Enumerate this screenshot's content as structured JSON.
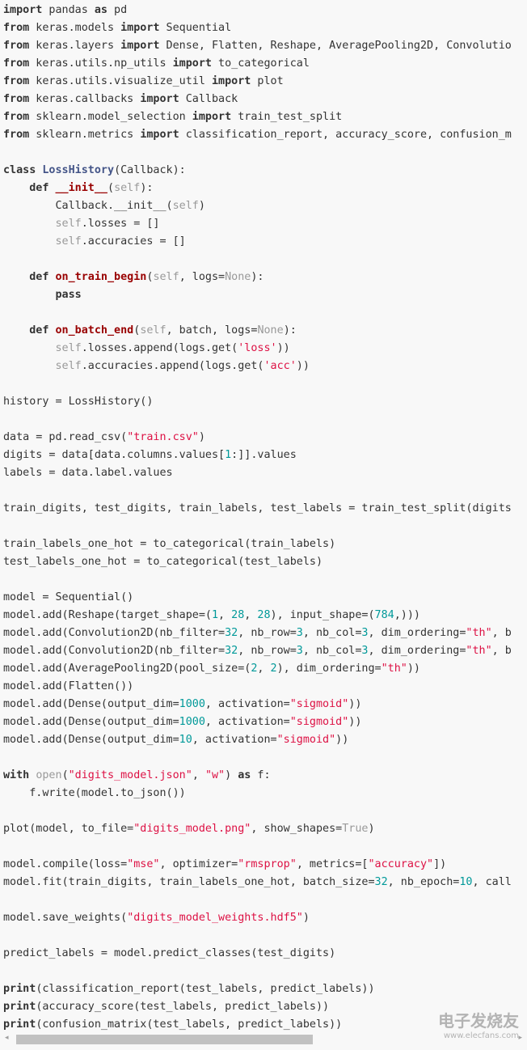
{
  "colors": {
    "background": "#f8f8f8",
    "keyword": "#333333",
    "function_name": "#990000",
    "class_name": "#445588",
    "self": "#999999",
    "string": "#dd1144",
    "number": "#009999"
  },
  "code_lines": [
    [
      [
        "k",
        "import"
      ],
      [
        "p",
        " pandas "
      ],
      [
        "k",
        "as"
      ],
      [
        "p",
        " pd"
      ]
    ],
    [
      [
        "k",
        "from"
      ],
      [
        "p",
        " keras.models "
      ],
      [
        "k",
        "import"
      ],
      [
        "p",
        " Sequential"
      ]
    ],
    [
      [
        "k",
        "from"
      ],
      [
        "p",
        " keras.layers "
      ],
      [
        "k",
        "import"
      ],
      [
        "p",
        " Dense, Flatten, Reshape, AveragePooling2D, Convolutio"
      ]
    ],
    [
      [
        "k",
        "from"
      ],
      [
        "p",
        " keras.utils.np_utils "
      ],
      [
        "k",
        "import"
      ],
      [
        "p",
        " to_categorical"
      ]
    ],
    [
      [
        "k",
        "from"
      ],
      [
        "p",
        " keras.utils.visualize_util "
      ],
      [
        "k",
        "import"
      ],
      [
        "p",
        " plot"
      ]
    ],
    [
      [
        "k",
        "from"
      ],
      [
        "p",
        " keras.callbacks "
      ],
      [
        "k",
        "import"
      ],
      [
        "p",
        " Callback"
      ]
    ],
    [
      [
        "k",
        "from"
      ],
      [
        "p",
        " sklearn.model_selection "
      ],
      [
        "k",
        "import"
      ],
      [
        "p",
        " train_test_split"
      ]
    ],
    [
      [
        "k",
        "from"
      ],
      [
        "p",
        " sklearn.metrics "
      ],
      [
        "k",
        "import"
      ],
      [
        "p",
        " classification_report, accuracy_score, confusion_m"
      ]
    ],
    [],
    [
      [
        "k",
        "class"
      ],
      [
        "p",
        " "
      ],
      [
        "c",
        "LossHistory"
      ],
      [
        "p",
        "(Callback):"
      ]
    ],
    [
      [
        "p",
        "    "
      ],
      [
        "k",
        "def"
      ],
      [
        "p",
        " "
      ],
      [
        "f",
        "__init__"
      ],
      [
        "p",
        "("
      ],
      [
        "s",
        "self"
      ],
      [
        "p",
        "):"
      ]
    ],
    [
      [
        "p",
        "        Callback.__init__("
      ],
      [
        "s",
        "self"
      ],
      [
        "p",
        ")"
      ]
    ],
    [
      [
        "p",
        "        "
      ],
      [
        "s",
        "self"
      ],
      [
        "p",
        ".losses = []"
      ]
    ],
    [
      [
        "p",
        "        "
      ],
      [
        "s",
        "self"
      ],
      [
        "p",
        ".accuracies = []"
      ]
    ],
    [],
    [
      [
        "p",
        "    "
      ],
      [
        "k",
        "def"
      ],
      [
        "p",
        " "
      ],
      [
        "f",
        "on_train_begin"
      ],
      [
        "p",
        "("
      ],
      [
        "s",
        "self"
      ],
      [
        "p",
        ", logs="
      ],
      [
        "b",
        "None"
      ],
      [
        "p",
        "):"
      ]
    ],
    [
      [
        "p",
        "        "
      ],
      [
        "k",
        "pass"
      ]
    ],
    [],
    [
      [
        "p",
        "    "
      ],
      [
        "k",
        "def"
      ],
      [
        "p",
        " "
      ],
      [
        "f",
        "on_batch_end"
      ],
      [
        "p",
        "("
      ],
      [
        "s",
        "self"
      ],
      [
        "p",
        ", batch, logs="
      ],
      [
        "b",
        "None"
      ],
      [
        "p",
        "):"
      ]
    ],
    [
      [
        "p",
        "        "
      ],
      [
        "s",
        "self"
      ],
      [
        "p",
        ".losses.append(logs.get("
      ],
      [
        "q",
        "'loss'"
      ],
      [
        "p",
        "))"
      ]
    ],
    [
      [
        "p",
        "        "
      ],
      [
        "s",
        "self"
      ],
      [
        "p",
        ".accuracies.append(logs.get("
      ],
      [
        "q",
        "'acc'"
      ],
      [
        "p",
        "))"
      ]
    ],
    [],
    [
      [
        "p",
        "history = LossHistory()"
      ]
    ],
    [],
    [
      [
        "p",
        "data = pd.read_csv("
      ],
      [
        "q",
        "\"train.csv\""
      ],
      [
        "p",
        ")"
      ]
    ],
    [
      [
        "p",
        "digits = data[data.columns.values["
      ],
      [
        "n",
        "1"
      ],
      [
        "p",
        ":]].values"
      ]
    ],
    [
      [
        "p",
        "labels = data.label.values"
      ]
    ],
    [],
    [
      [
        "p",
        "train_digits, test_digits, train_labels, test_labels = train_test_split(digits"
      ]
    ],
    [],
    [
      [
        "p",
        "train_labels_one_hot = to_categorical(train_labels)"
      ]
    ],
    [
      [
        "p",
        "test_labels_one_hot = to_categorical(test_labels)"
      ]
    ],
    [],
    [
      [
        "p",
        "model = Sequential()"
      ]
    ],
    [
      [
        "p",
        "model.add(Reshape(target_shape=("
      ],
      [
        "n",
        "1"
      ],
      [
        "p",
        ", "
      ],
      [
        "n",
        "28"
      ],
      [
        "p",
        ", "
      ],
      [
        "n",
        "28"
      ],
      [
        "p",
        "), input_shape=("
      ],
      [
        "n",
        "784"
      ],
      [
        "p",
        ",)))"
      ]
    ],
    [
      [
        "p",
        "model.add(Convolution2D(nb_filter="
      ],
      [
        "n",
        "32"
      ],
      [
        "p",
        ", nb_row="
      ],
      [
        "n",
        "3"
      ],
      [
        "p",
        ", nb_col="
      ],
      [
        "n",
        "3"
      ],
      [
        "p",
        ", dim_ordering="
      ],
      [
        "q",
        "\"th\""
      ],
      [
        "p",
        ", b"
      ]
    ],
    [
      [
        "p",
        "model.add(Convolution2D(nb_filter="
      ],
      [
        "n",
        "32"
      ],
      [
        "p",
        ", nb_row="
      ],
      [
        "n",
        "3"
      ],
      [
        "p",
        ", nb_col="
      ],
      [
        "n",
        "3"
      ],
      [
        "p",
        ", dim_ordering="
      ],
      [
        "q",
        "\"th\""
      ],
      [
        "p",
        ", b"
      ]
    ],
    [
      [
        "p",
        "model.add(AveragePooling2D(pool_size=("
      ],
      [
        "n",
        "2"
      ],
      [
        "p",
        ", "
      ],
      [
        "n",
        "2"
      ],
      [
        "p",
        "), dim_ordering="
      ],
      [
        "q",
        "\"th\""
      ],
      [
        "p",
        "))"
      ]
    ],
    [
      [
        "p",
        "model.add(Flatten())"
      ]
    ],
    [
      [
        "p",
        "model.add(Dense(output_dim="
      ],
      [
        "n",
        "1000"
      ],
      [
        "p",
        ", activation="
      ],
      [
        "q",
        "\"sigmoid\""
      ],
      [
        "p",
        "))"
      ]
    ],
    [
      [
        "p",
        "model.add(Dense(output_dim="
      ],
      [
        "n",
        "1000"
      ],
      [
        "p",
        ", activation="
      ],
      [
        "q",
        "\"sigmoid\""
      ],
      [
        "p",
        "))"
      ]
    ],
    [
      [
        "p",
        "model.add(Dense(output_dim="
      ],
      [
        "n",
        "10"
      ],
      [
        "p",
        ", activation="
      ],
      [
        "q",
        "\"sigmoid\""
      ],
      [
        "p",
        "))"
      ]
    ],
    [],
    [
      [
        "k",
        "with"
      ],
      [
        "p",
        " "
      ],
      [
        "b",
        "open"
      ],
      [
        "p",
        "("
      ],
      [
        "q",
        "\"digits_model.json\""
      ],
      [
        "p",
        ", "
      ],
      [
        "q",
        "\"w\""
      ],
      [
        "p",
        ") "
      ],
      [
        "k",
        "as"
      ],
      [
        "p",
        " f:"
      ]
    ],
    [
      [
        "p",
        "    f.write(model.to_json())"
      ]
    ],
    [],
    [
      [
        "p",
        "plot(model, to_file="
      ],
      [
        "q",
        "\"digits_model.png\""
      ],
      [
        "p",
        ", show_shapes="
      ],
      [
        "b",
        "True"
      ],
      [
        "p",
        ")"
      ]
    ],
    [],
    [
      [
        "p",
        "model.compile(loss="
      ],
      [
        "q",
        "\"mse\""
      ],
      [
        "p",
        ", optimizer="
      ],
      [
        "q",
        "\"rmsprop\""
      ],
      [
        "p",
        ", metrics=["
      ],
      [
        "q",
        "\"accuracy\""
      ],
      [
        "p",
        "])"
      ]
    ],
    [
      [
        "p",
        "model.fit(train_digits, train_labels_one_hot, batch_size="
      ],
      [
        "n",
        "32"
      ],
      [
        "p",
        ", nb_epoch="
      ],
      [
        "n",
        "10"
      ],
      [
        "p",
        ", call"
      ]
    ],
    [],
    [
      [
        "p",
        "model.save_weights("
      ],
      [
        "q",
        "\"digits_model_weights.hdf5\""
      ],
      [
        "p",
        ")"
      ]
    ],
    [],
    [
      [
        "p",
        "predict_labels = model.predict_classes(test_digits)"
      ]
    ],
    [],
    [
      [
        "k",
        "print"
      ],
      [
        "p",
        "(classification_report(test_labels, predict_labels))"
      ]
    ],
    [
      [
        "k",
        "print"
      ],
      [
        "p",
        "(accuracy_score(test_labels, predict_labels))"
      ]
    ],
    [
      [
        "k",
        "print"
      ],
      [
        "p",
        "(confusion_matrix(test_labels, predict_labels))"
      ]
    ]
  ],
  "scrollbar": {
    "left_arrow": "◂",
    "right_arrow": "▸",
    "position_fraction": 0.0,
    "visible_fraction": 0.6
  },
  "watermark": {
    "title": "电子发烧友",
    "url": "www.elecfans.com"
  }
}
